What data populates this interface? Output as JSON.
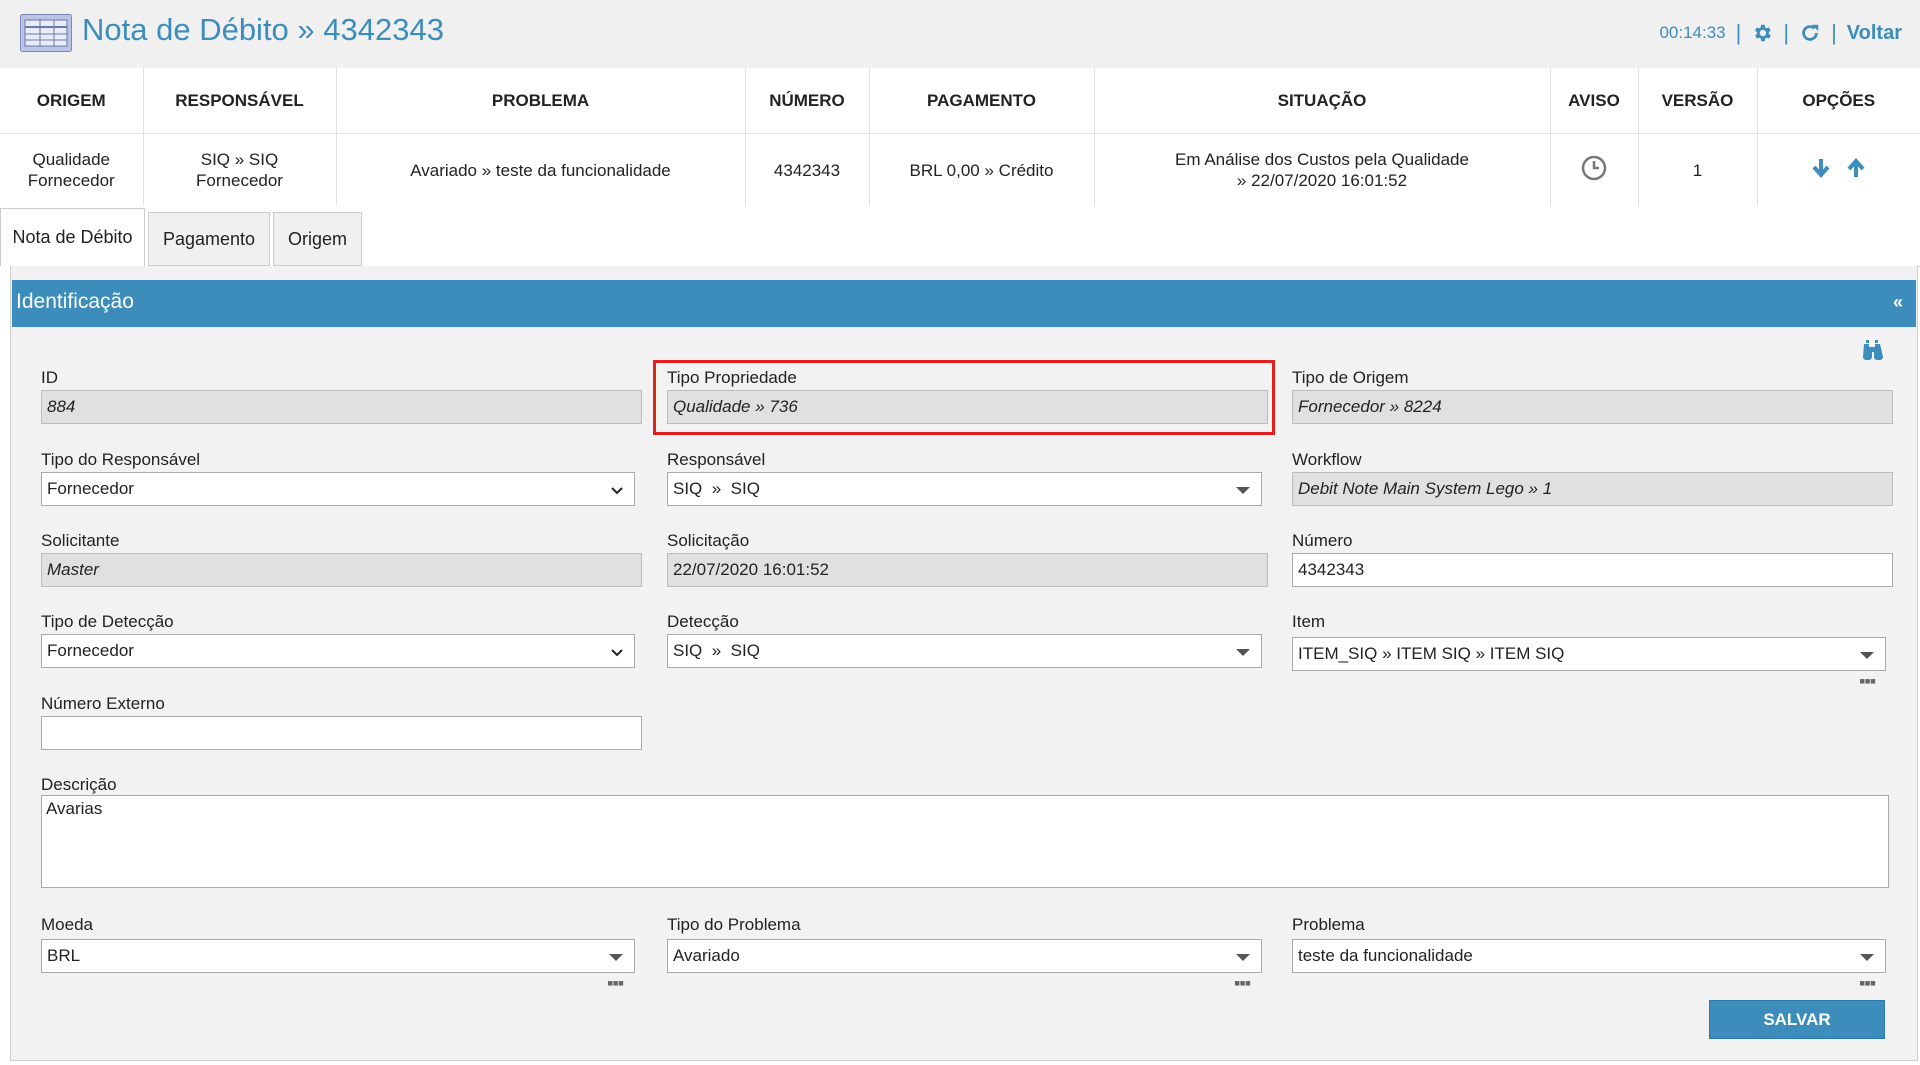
{
  "header": {
    "title": "Nota de Débito » 4342343",
    "timer": "00:14:33",
    "back_label": "Voltar",
    "icons": [
      "table-icon",
      "gear-icon",
      "refresh-icon"
    ]
  },
  "summary": {
    "columns": [
      "ORIGEM",
      "RESPONSÁVEL",
      "PROBLEMA",
      "NÚMERO",
      "PAGAMENTO",
      "SITUAÇÃO",
      "AVISO",
      "VERSÃO",
      "OPÇÕES"
    ],
    "row": {
      "origem_1": "Qualidade",
      "origem_2": "Fornecedor",
      "responsavel_1": "SIQ » SIQ",
      "responsavel_2": "Fornecedor",
      "problema": "Avariado » teste da funcionalidade",
      "numero": "4342343",
      "pagamento": "BRL 0,00 » Crédito",
      "situacao_1": "Em Análise dos Custos pela Qualidade",
      "situacao_2": "» 22/07/2020 16:01:52",
      "aviso_icon": "clock-icon",
      "versao": "1",
      "opcoes_icons": [
        "arrow-down-icon",
        "arrow-up-icon"
      ]
    }
  },
  "tabs": [
    {
      "label": "Nota de Débito",
      "active": true
    },
    {
      "label": "Pagamento",
      "active": false
    },
    {
      "label": "Origem",
      "active": false
    }
  ],
  "panel": {
    "title": "Identificação",
    "collapse_glyph": "«"
  },
  "form": {
    "id": {
      "label": "ID",
      "value": "884"
    },
    "tipo_propriedade": {
      "label": "Tipo Propriedade",
      "value": "Qualidade » 736"
    },
    "tipo_origem": {
      "label": "Tipo de Origem",
      "value": "Fornecedor » 8224"
    },
    "tipo_responsavel": {
      "label": "Tipo do Responsável",
      "value": "Fornecedor"
    },
    "responsavel": {
      "label": "Responsável",
      "value": "SIQ  »  SIQ"
    },
    "workflow": {
      "label": "Workflow",
      "value": "Debit Note Main System Lego » 1"
    },
    "solicitante": {
      "label": "Solicitante",
      "value": "Master"
    },
    "solicitacao": {
      "label": "Solicitação",
      "value": "22/07/2020 16:01:52"
    },
    "numero": {
      "label": "Número",
      "value": "4342343"
    },
    "tipo_deteccao": {
      "label": "Tipo de Detecção",
      "value": "Fornecedor"
    },
    "deteccao": {
      "label": "Detecção",
      "value": "SIQ  »  SIQ"
    },
    "item": {
      "label": "Item",
      "value": "ITEM_SIQ » ITEM SIQ » ITEM SIQ"
    },
    "numero_externo": {
      "label": "Número Externo",
      "value": ""
    },
    "descricao": {
      "label": "Descrição",
      "value": "Avarias"
    },
    "moeda": {
      "label": "Moeda",
      "value": "BRL"
    },
    "tipo_problema": {
      "label": "Tipo do Problema",
      "value": "Avariado"
    },
    "problema": {
      "label": "Problema",
      "value": "teste da funcionalidade"
    }
  },
  "buttons": {
    "save_label": "SALVAR"
  },
  "colors": {
    "accent": "#3c8dbc",
    "highlight": "#e02020"
  }
}
